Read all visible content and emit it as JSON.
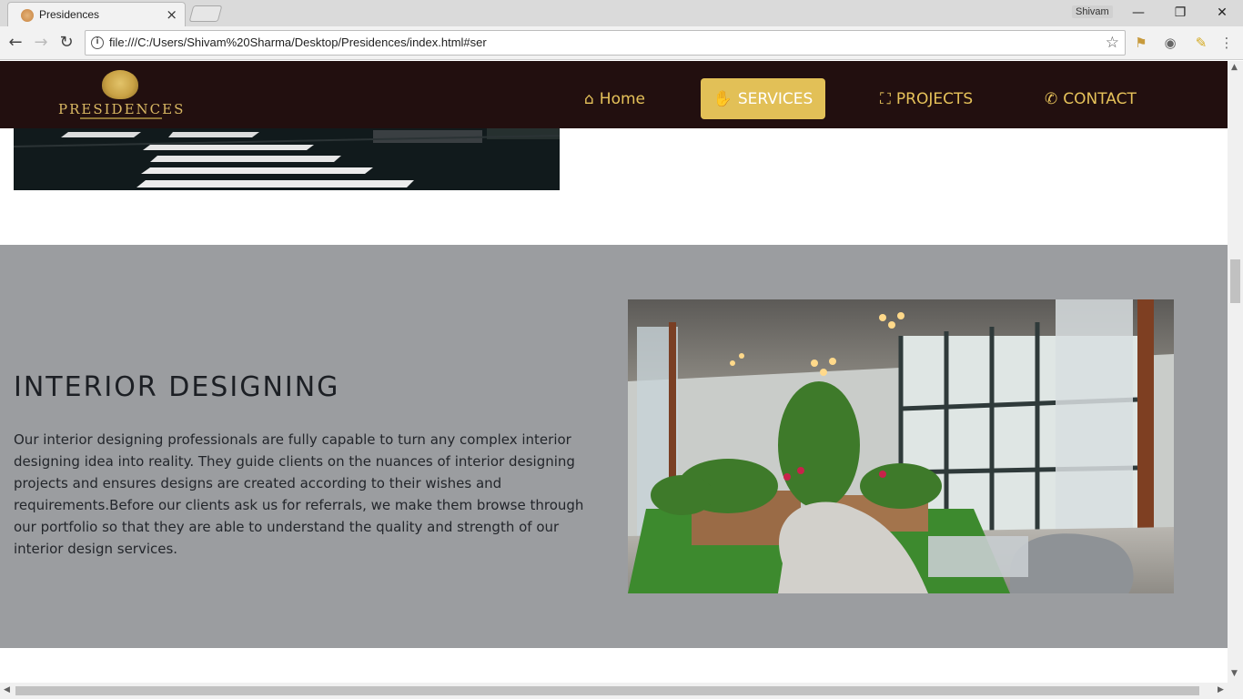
{
  "browser": {
    "tab_title": "Presidences",
    "tab_close": "×",
    "profile_name": "Shivam",
    "window_minimize": "—",
    "window_restore": "❐",
    "window_close": "✕",
    "back": "←",
    "forward": "→",
    "reload": "↻",
    "url": "file:///C:/Users/Shivam%20Sharma/Desktop/Presidences/index.html#ser",
    "info": "i",
    "star": "☆",
    "menu": "⋮"
  },
  "site": {
    "logo_text": "PRESIDENCES",
    "nav": [
      {
        "label": "Home",
        "icon": "⌂",
        "icon_name": "home-icon",
        "active": false
      },
      {
        "label": "SERVICES",
        "icon": "✋",
        "icon_name": "handshake-icon",
        "active": true
      },
      {
        "label": "PROJECTS",
        "icon": "⛶",
        "icon_name": "sitemap-icon",
        "active": false
      },
      {
        "label": "CONTACT",
        "icon": "✆",
        "icon_name": "phone-icon",
        "active": false
      }
    ],
    "accent_color": "#e2c057",
    "nav_bg": "#220f0f",
    "section_bg": "#9b9da0"
  },
  "section": {
    "title": "INTERIOR DESIGNING",
    "body": "Our interior designing professionals are fully capable to turn any complex interior designing idea into reality. They guide clients on the nuances of interior designing projects and ensures designs are created according to their wishes and requirements.Before our clients ask us for referrals, we make them browse through our portfolio so that they are able to understand the quality and strength of our interior design services."
  }
}
